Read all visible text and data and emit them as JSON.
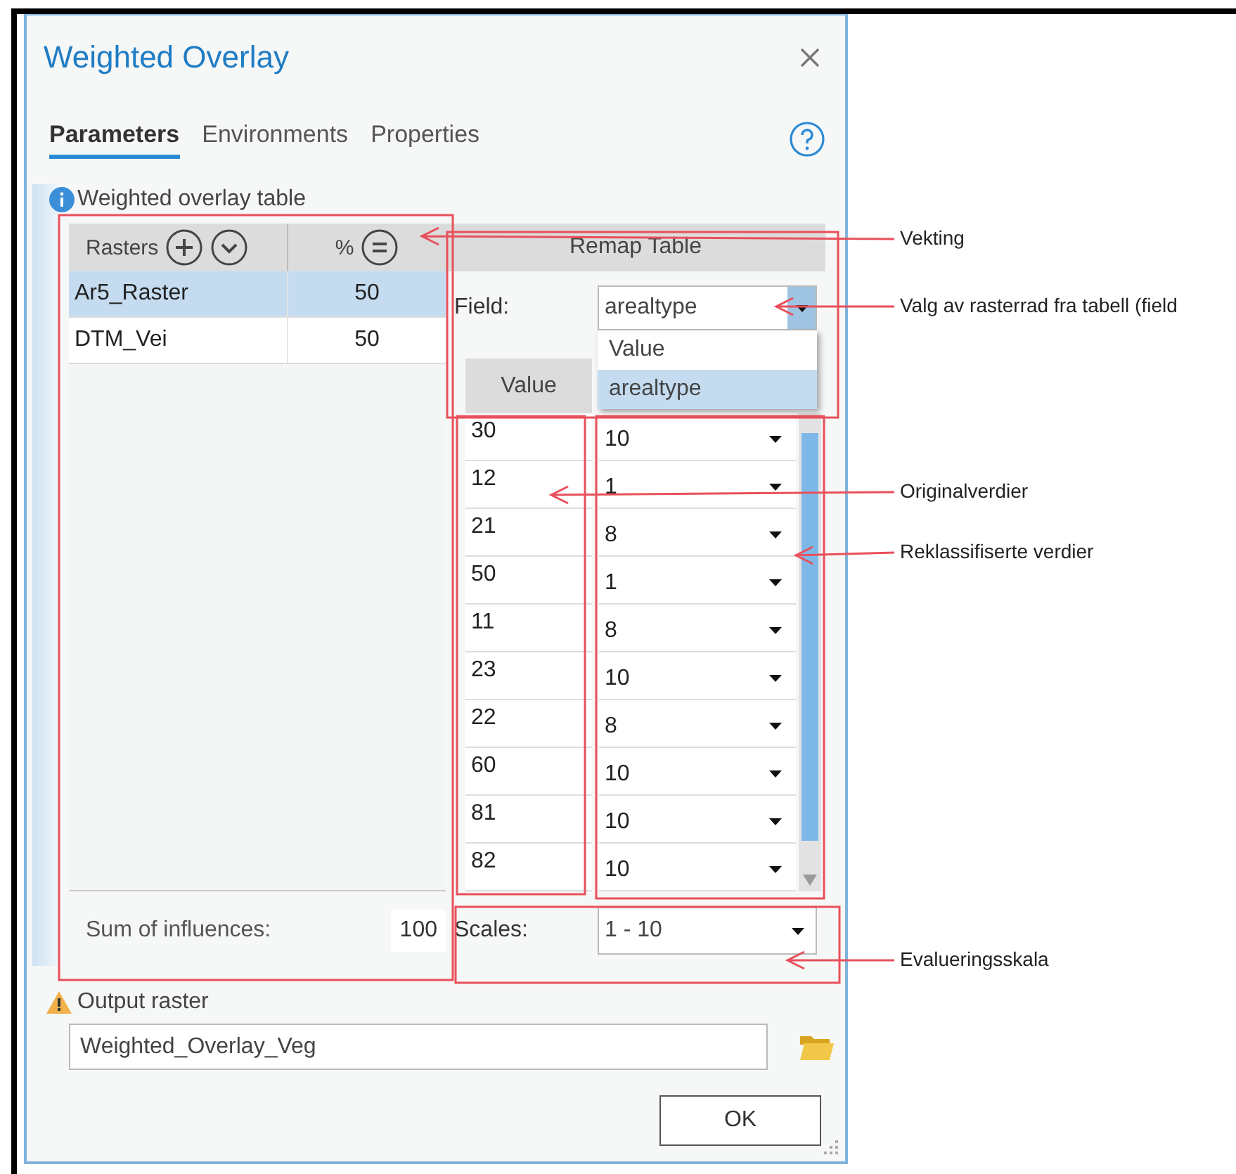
{
  "dialog": {
    "title": "Weighted Overlay",
    "tabs": [
      {
        "label": "Parameters",
        "selected": true
      },
      {
        "label": "Environments",
        "selected": false
      },
      {
        "label": "Properties",
        "selected": false
      }
    ],
    "section_label": "Weighted overlay table",
    "rasters_table": {
      "columns": [
        "Rasters",
        "%"
      ],
      "rows": [
        {
          "name": "Ar5_Raster",
          "percent": "50",
          "selected": true
        },
        {
          "name": "DTM_Vei",
          "percent": "50",
          "selected": false
        }
      ],
      "sum_label": "Sum of influences:",
      "sum_value": "100"
    },
    "remap_table": {
      "title": "Remap Table",
      "field_label": "Field:",
      "field_value": "arealtype",
      "field_options": [
        {
          "label": "Value",
          "selected": false
        },
        {
          "label": "arealtype",
          "selected": true
        }
      ],
      "value_column": "Value",
      "rows": [
        {
          "value": "30",
          "new_value": "10"
        },
        {
          "value": "12",
          "new_value": "1"
        },
        {
          "value": "21",
          "new_value": "8"
        },
        {
          "value": "50",
          "new_value": "1"
        },
        {
          "value": "11",
          "new_value": "8"
        },
        {
          "value": "23",
          "new_value": "10"
        },
        {
          "value": "22",
          "new_value": "8"
        },
        {
          "value": "60",
          "new_value": "10"
        },
        {
          "value": "81",
          "new_value": "10"
        },
        {
          "value": "82",
          "new_value": "10"
        }
      ],
      "scales_label": "Scales:",
      "scales_value": "1 - 10"
    },
    "output": {
      "label": "Output raster",
      "value": "Weighted_Overlay_Veg"
    },
    "buttons": [
      "OK"
    ]
  },
  "annotations": [
    {
      "text": "Vekting"
    },
    {
      "text": "Valg av rasterrad fra tabell (field"
    },
    {
      "text": "Originalverdier"
    },
    {
      "text": "Reklassifiserte verdier"
    },
    {
      "text": "Evalueringsskala"
    }
  ]
}
